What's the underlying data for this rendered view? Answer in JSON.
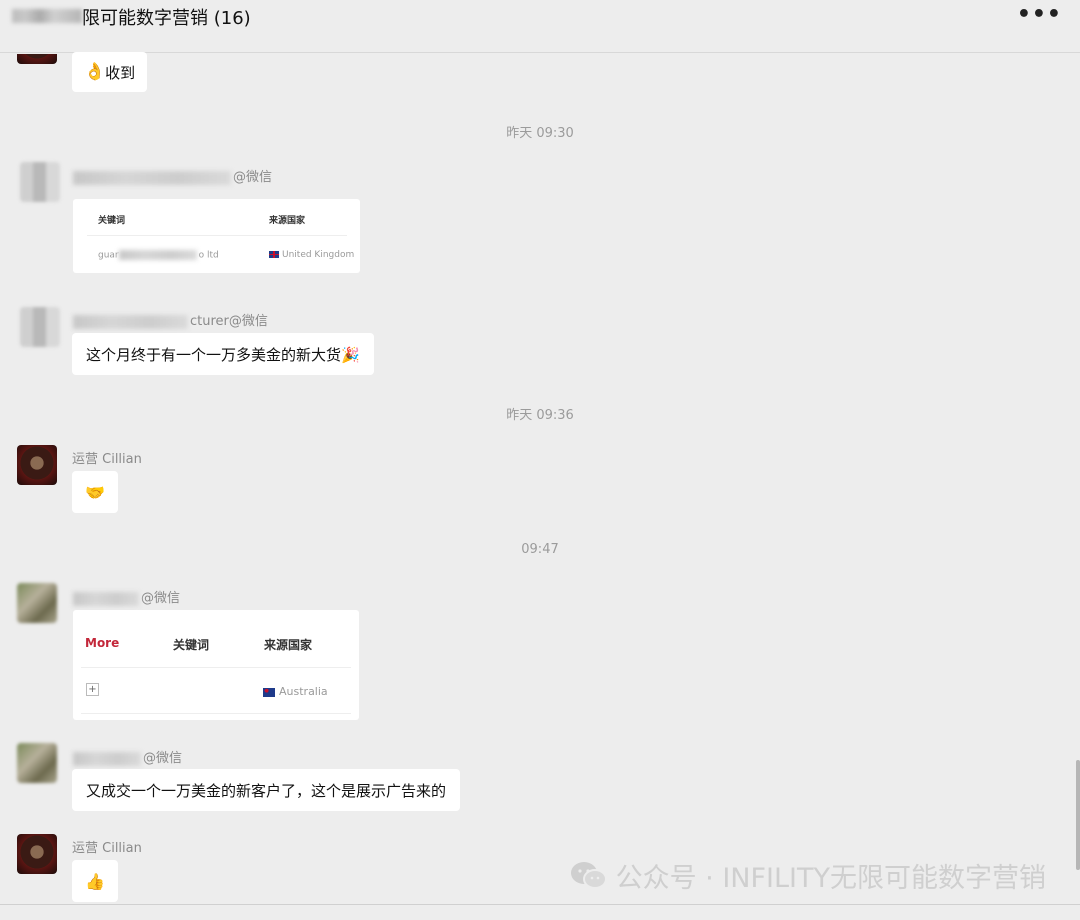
{
  "header": {
    "title": "限可能数字营销 (16)",
    "more_icon": "•••"
  },
  "messages": [
    {
      "emoji": "👌",
      "text": "收到"
    },
    {
      "sender_suffix": "@微信"
    },
    {
      "sender_suffix": "cturer@微信",
      "text": "这个月终于有一个一万多美金的新大货🎉"
    },
    {
      "sender": "运营 Cillian",
      "emoji": "🤝"
    },
    {
      "sender_suffix": "@微信"
    },
    {
      "sender_suffix": "@微信",
      "text": "又成交一个一万美金的新客户了，这个是展示广告来的"
    },
    {
      "sender": "运营 Cillian",
      "emoji": "👍"
    }
  ],
  "timestamps": [
    "昨天 09:30",
    "昨天 09:36",
    "09:47"
  ],
  "card1": {
    "col1": "关键词",
    "col2": "来源国家",
    "row_kw_start": "guar",
    "row_kw_end": "o ltd",
    "country": "United Kingdom"
  },
  "card2": {
    "more": "More",
    "col1": "关键词",
    "col2": "来源国家",
    "plus": "+",
    "country": "Australia"
  },
  "watermark": "公众号 · INFILITY无限可能数字营销",
  "colors": {
    "background": "#ededed",
    "bubble": "#ffffff",
    "more_red": "#c3273a"
  }
}
